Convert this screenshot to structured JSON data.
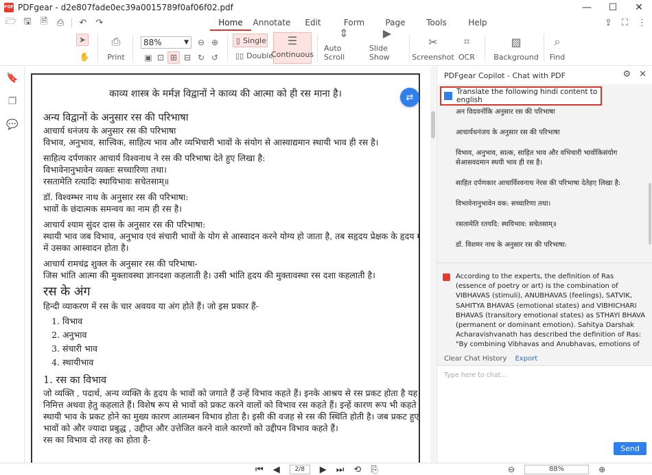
{
  "app": {
    "title": "PDFgear - d2e807fade0ec39a0015789f0af06f02.pdf",
    "logo_text": "PDF"
  },
  "window_controls": [
    "—",
    "☐",
    "✕"
  ],
  "menus": [
    "Home",
    "Annotate",
    "Edit",
    "Form",
    "Page",
    "Tools",
    "Help"
  ],
  "active_menu": "Home",
  "toolbar": {
    "print_label": "Print",
    "zoom_value": "88%",
    "single_label": "Single",
    "double_label": "Double",
    "continuous_label": "Continuous",
    "auto_scroll_label": "Auto Scroll",
    "slide_show_label": "Slide Show",
    "screenshot_label": "Screenshot",
    "ocr_label": "OCR",
    "background_label": "Background",
    "find_label": "Find"
  },
  "document": {
    "lines": [
      "काव्य शास्त्र के मर्मज्ञ विद्वानों ने काव्य की आत्मा को ही रस माना है।",
      "अन्य विद्वानों के अनुसार रस की परिभाषा",
      "आचार्य धनंजय के अनुसार रस की परिभाषा",
      "विभाव, अनुभाव, सात्त्विक, साहित्य भाव और व्यभिचारी भावों के संयोग से आस्वाद्यमान स्थायी भाव ही रस है।",
      "साहित्य दर्पणकार आचार्य विश्वनाथ ने रस की परिभाषा देते हुए लिखा है:",
      "विभावेनानुभावेन व्यक्तः सच्चारिणा तथा।",
      "रसतामेति रत्यादिः स्थायिभावः सचेतसाम्॥",
      "डॉ. विश्वम्भर नाथ के अनुसार रस की परिभाषा:",
      "भावों के छंदात्मक समन्वय का नाम ही रस है।",
      "आचार्य श्याम सुंदर दास के अनुसार रस की परिभाषा:",
      "स्थायी भाव जब विभाव, अनुभाव एवं संचारी भावों के योग से आस्वादन करने योग्य हो जाता है, तब सहृदय प्रेक्षक के हृदय में रस रूप",
      "में उसका आस्वादन होता है।",
      "आचार्य रामचंद्र शुक्ल के अनुसार रस की परिभाषा-",
      "जिस भांति आत्मा की मुक्तावस्था ज्ञानदशा कहलाती है। उसी भांति हृदय की मुक्तावस्था रस दशा कहलाती है।",
      "रस के अंग",
      "हिन्दी व्याकरण में रस के चार अवयव या अंग होते हैं। जो इस प्रकार हैं-"
    ],
    "list": [
      "विभाव",
      "अनुभाव",
      "संचारी भाव",
      "स्थायीभाव"
    ],
    "section_title": "1. रस का विभाव",
    "para_lines": [
      "जो व्यक्ति , पदार्थ, अन्य व्यक्ति के हृदय के भावों को जगाते हैं उन्हें विभाव कहते हैं। इनके आश्रय से रस प्रकट होता है यह कारण",
      "निमित्त अथवा हेतु कहलाते हैं। विशेष रूप से भावों को प्रकट करने वालों को विभाव रस कहते हैं। इन्हें कारण रूप भी कहते हैं।",
      "स्थायी भाव के प्रकट होने का मुख्य कारण आलम्बन विभाव होता है। इसी की वजह से रस की स्थिति होती है। जब प्रकट हुए स्थायी",
      "भावों को और ज्यादा प्रबुद्ध , उद्दीप्त और उत्तेजित करने वाले कारणों को उद्दीपन विभाव कहते हैं।",
      "रस का विभाव दो तरह का होता है-"
    ]
  },
  "copilot": {
    "title": "PDFgear Copilot - Chat with PDF",
    "user_message": "Translate the following hindi content to english",
    "pasted_lines": [
      "अन विदवनोंकि अनुसार रस की परिभाषा",
      "आचार्यधनंजय के अनुसार रस की परिभाषा",
      "विभाव, अनुभाव, सात्क, साहित भाव और वभिचारी भावोंकिसंयोग",
      "सेआसवदमान स्थयी भाव ही रस है।",
      "साहित दर्पणकार आचार्विश्वनाथ नेरस की परिभाषा देतेहए लिखा है:",
      "विभावेनानुभावेन वक: सच्चारिणा तथा।",
      "रसतामेति रतयदि: स्थयिभाव: सचेतसाम्॥",
      "डॉ. विशमर नाथ के अनुसार रस की परिभाषा:"
    ],
    "ai_response": "According to the experts, the definition of Ras (essence of poetry or art) is the combination of VIBHAVAS (stimuli), ANUBHAVAS (feelings), SATVIK, SAHITYA BHAVAS (emotional states) and VIBHICHARI BHAVAS (transitory emotional states) as STHAYI BHAVA (permanent or dominant emotion). Sahitya Darshak Acharavishvanath has described the definition of Ras: \"By combining Vibhavas and Anubhavas, emotions of characters are evoked in the audience. When these are experienced",
    "clear_label": "Clear Chat History",
    "export_label": "Export",
    "input_placeholder": "Type here to chat...",
    "send_label": "Send"
  },
  "statusbar": {
    "page_indicator": "2/8",
    "zoom_value": "88%"
  },
  "colors": {
    "accent_red": "#d9362b",
    "accent_blue": "#2f80ed"
  }
}
